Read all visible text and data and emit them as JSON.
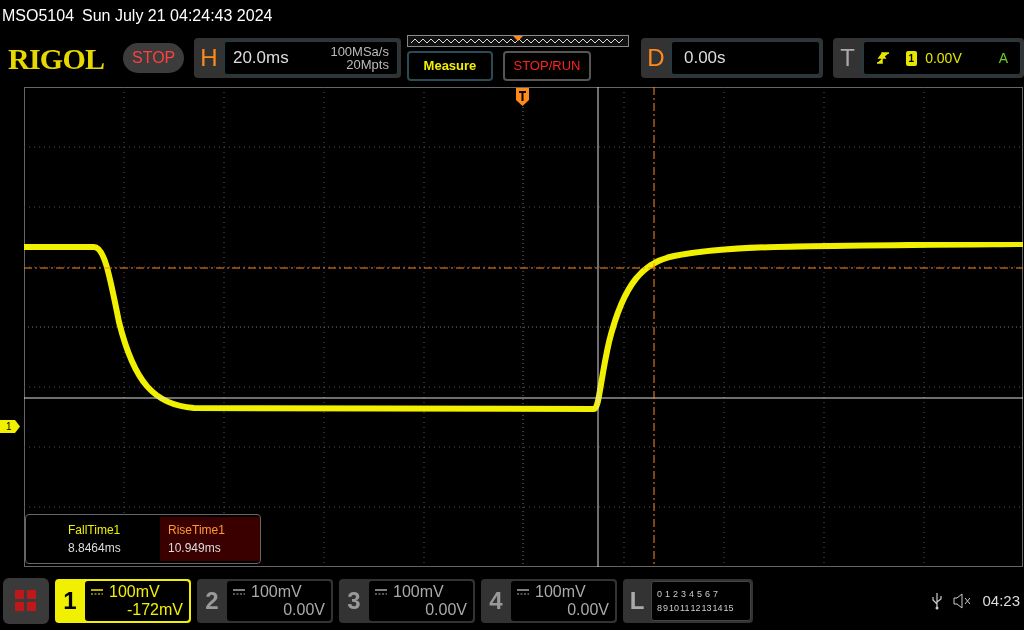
{
  "model": "MSO5104",
  "datetime": "Sun July 21 04:24:43 2024",
  "logo": "RIGOL",
  "run_state": "STOP",
  "horizontal": {
    "label": "H",
    "timebase": "20.0ms",
    "sample_rate": "100MSa/s",
    "memory_depth": "20Mpts"
  },
  "buttons": [
    {
      "label": "Measure",
      "kind": "measure"
    },
    {
      "label": "STOP/RUN",
      "kind": "stoprun"
    }
  ],
  "delay": {
    "label": "D",
    "value": "0.00s"
  },
  "trigger": {
    "label": "T",
    "source": "1",
    "level": "0.00V",
    "mode": "A"
  },
  "channel_marker": "1",
  "measurements": [
    {
      "name": "FallTime1",
      "value": "8.8464ms",
      "selected": false
    },
    {
      "name": "RiseTime1",
      "value": "10.949ms",
      "selected": true
    }
  ],
  "channels": [
    {
      "number": "1",
      "scale": "100mV",
      "offset": "-172mV",
      "on": true
    },
    {
      "number": "2",
      "scale": "100mV",
      "offset": "0.00V",
      "on": false
    },
    {
      "number": "3",
      "scale": "100mV",
      "offset": "0.00V",
      "on": false
    },
    {
      "number": "4",
      "scale": "100mV",
      "offset": "0.00V",
      "on": false
    }
  ],
  "logic": {
    "label": "L",
    "row_1": [
      "0",
      "1",
      "2",
      "3",
      "4",
      "5",
      "6",
      "7"
    ],
    "row_2": [
      "8",
      "9",
      "10",
      "11",
      "12",
      "13",
      "14",
      "15"
    ]
  },
  "clock": "04:23"
}
